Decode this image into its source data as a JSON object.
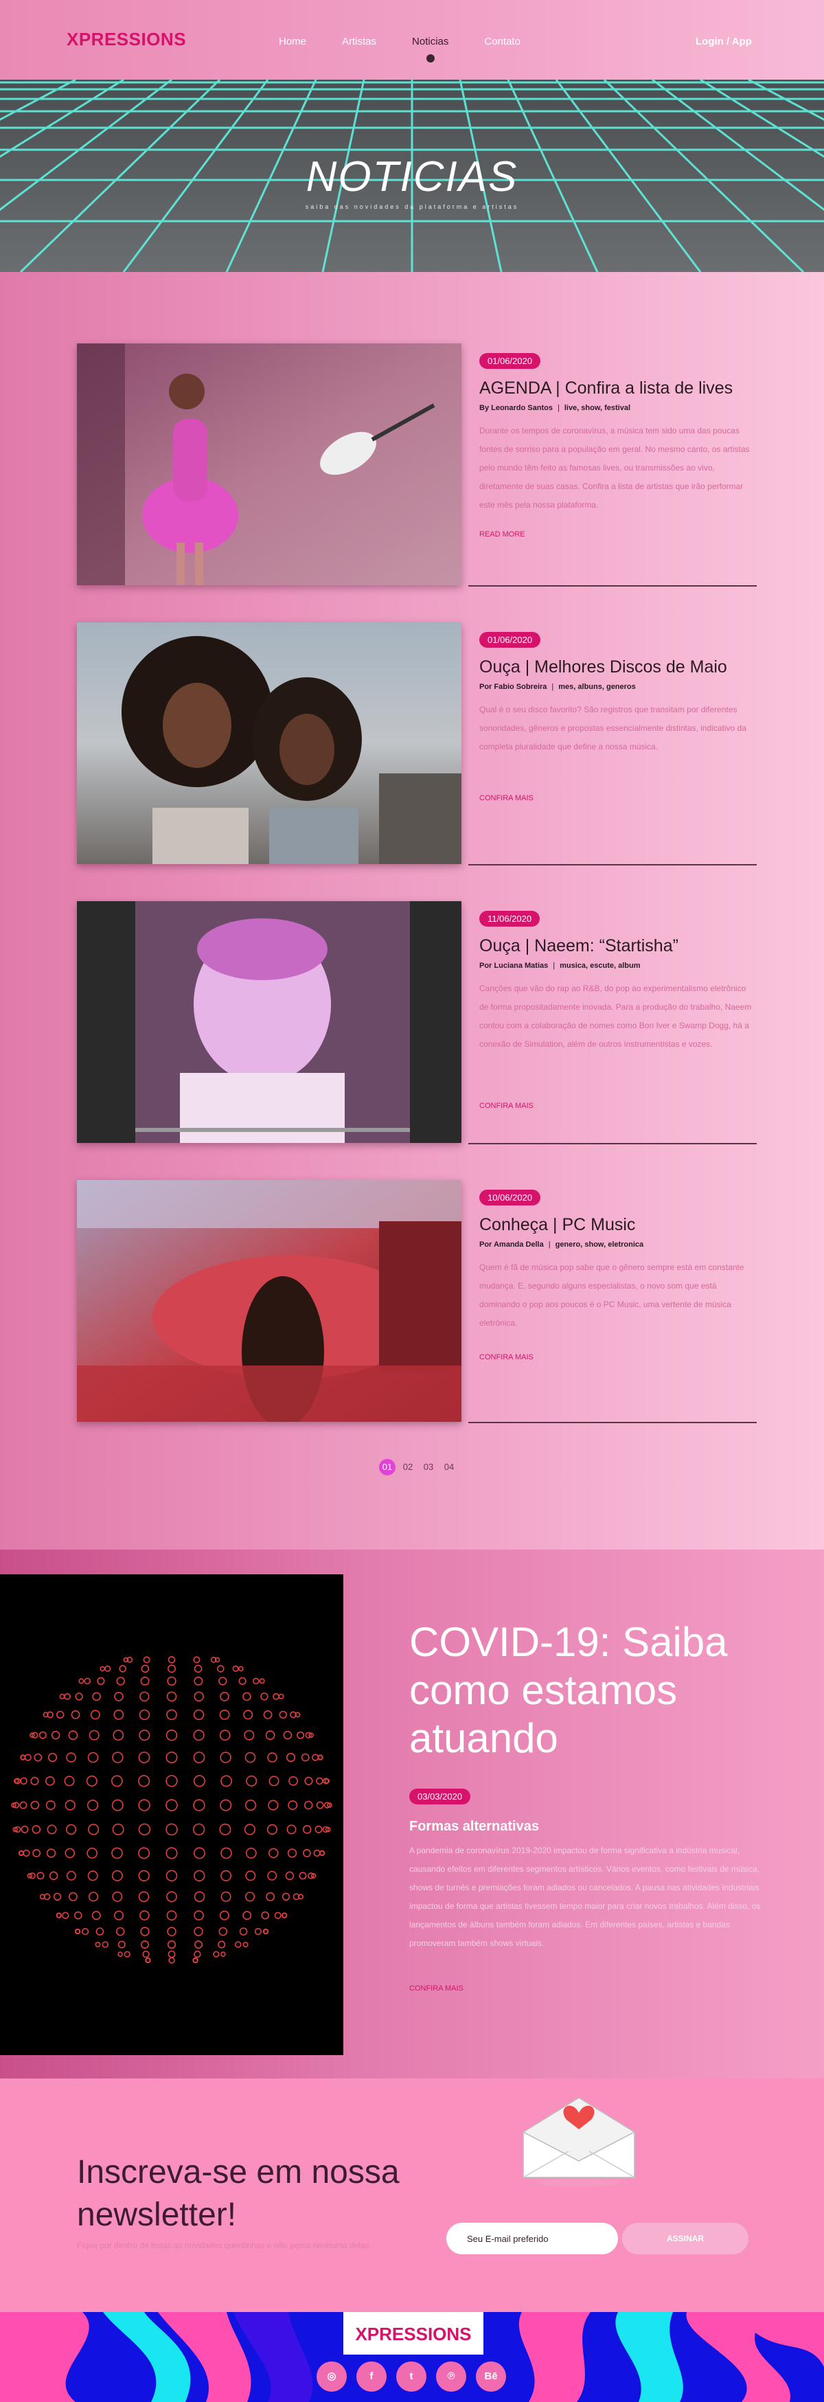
{
  "header": {
    "logo": "XPRESSIONS",
    "nav": [
      {
        "label": "Home"
      },
      {
        "label": "Artistas"
      },
      {
        "label": "Noticias"
      },
      {
        "label": "Contato"
      }
    ],
    "login_label": "Login / App"
  },
  "hero": {
    "title": "NOTICIAS",
    "subtitle": "saiba das novidades da plataforma e artistas"
  },
  "news": [
    {
      "date": "01/06/2020",
      "title": "AGENDA | Confira a lista de lives",
      "author": "By Leonardo Santos",
      "tags": "live, show, festival",
      "text": "Durante os tempos de coronavírus, a música tem sido uma das poucas fontes de sorriso para a população em geral. No mesmo canto, os artistas pelo mundo têm feito as famosas lives, ou transmissões ao vivo, diretamente de suas casas. Confira a lista de artistas que irão performar este mês pela nossa plataforma.",
      "read_more": "READ MORE"
    },
    {
      "date": "01/06/2020",
      "title": "Ouça | Melhores Discos de Maio",
      "author": "Por Fabio Sobreira",
      "tags": "mes, albuns, generos",
      "text": "Qual é o seu disco favorito? São registros que transitam por diferentes sonoridades, gêneros e propostas essencialmente distintas, indicativo da completa pluralidade que define a nossa música.",
      "read_more": "CONFIRA MAIS"
    },
    {
      "date": "11/06/2020",
      "title": "Ouça | Naeem: “Startisha”",
      "author": "Por Luciana Matias",
      "tags": "musica, escute, album",
      "text": "Canções que vão do rap ao R&B, do pop ao experimentalismo eletrônico de forma propositadamente inovada. Para a produção do trabalho, Naeem contou com a colaboração de nomes como Bon Iver e Swamp Dogg, há a conexão de Simulation, além de outros instrumentistas e vozes.",
      "read_more": "CONFIRA MAIS"
    },
    {
      "date": "10/06/2020",
      "title": "Conheça | PC Music",
      "author": "Por Amanda Della",
      "tags": "genero, show, eletronica",
      "text": "Quem é fã de música pop sabe que o gênero sempre está em constante mudança. E, segundo alguns especialistas, o novo som que está dominando o pop aos poucos é o PC Music, uma vertente de música eletrônica.",
      "read_more": "CONFIRA MAIS"
    }
  ],
  "pagination": [
    "01",
    "02",
    "03",
    "04"
  ],
  "covid": {
    "title": "COVID-19: Saiba como estamos atuando",
    "date": "03/03/2020",
    "subtitle": "Formas alternativas",
    "text": "A pandemia de coronavírus 2019-2020 impactou de forma significativa a indústria musical, causando efeitos em diferentes segmentos artísticos. Vários eventos, como festivais de música, shows de turnês e premiações foram adiados ou cancelados. A pausa nas atividades industriais impactou de forma que artistas tivessem tempo maior para criar novos trabalhos. Além disso, os lançamentos de álbuns também foram adiados. Em diferentes países, artistas e bandas promoveram também shows virtuais.",
    "read_more": "CONFIRA MAIS"
  },
  "newsletter": {
    "title": "Inscreva-se em nossa newsletter!",
    "subtitle": "Fique por dentro de todas as novidades quentinhas e não perca nenhuma delas.",
    "input_placeholder": "Seu E-mail preferido",
    "button_label": "ASSINAR"
  },
  "footer": {
    "logo": "XPRESSIONS",
    "socials": [
      {
        "icon": "instagram-icon",
        "glyph": "◎"
      },
      {
        "icon": "facebook-icon",
        "glyph": "f"
      },
      {
        "icon": "twitter-icon",
        "glyph": "t"
      },
      {
        "icon": "pinterest-icon",
        "glyph": "℗"
      },
      {
        "icon": "behance-icon",
        "glyph": "Bē"
      }
    ]
  },
  "colors": {
    "brand": "#d6126b",
    "accent": "#e043d7",
    "grid": "#5ff0e0"
  }
}
